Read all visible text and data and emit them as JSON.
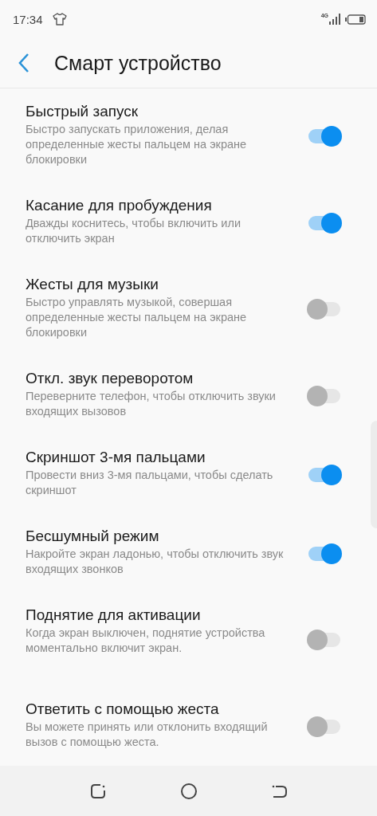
{
  "status_bar": {
    "time": "17:34",
    "network": "4G"
  },
  "header": {
    "title": "Смарт устройство"
  },
  "settings": [
    {
      "title": "Быстрый запуск",
      "description": "Быстро запускать приложения, делая определенные жесты пальцем на экране блокировки",
      "on": true
    },
    {
      "title": "Касание для пробуждения",
      "description": "Дважды коснитесь, чтобы включить или отключить экран",
      "on": true
    },
    {
      "title": "Жесты для музыки",
      "description": "Быстро управлять музыкой, совершая определенные жесты пальцем на экране блокировки",
      "on": false
    },
    {
      "title": "Откл. звук переворотом",
      "description": "Переверните телефон, чтобы отключить звуки входящих вызовов",
      "on": false
    },
    {
      "title": "Скриншот 3-мя пальцами",
      "description": "Провести вниз 3-мя пальцами, чтобы сделать скриншот",
      "on": true
    },
    {
      "title": "Бесшумный режим",
      "description": "Накройте экран ладонью, чтобы отключить звук входящих звонков",
      "on": true
    },
    {
      "title": "Поднятие для активации",
      "description": "Когда экран выключен, поднятие устройства моментально включит экран.",
      "on": false
    },
    {
      "title": "Ответить с помощью жеста",
      "description": "Вы можете принять или отклонить входящий вызов с помощью жеста.",
      "on": false
    }
  ]
}
